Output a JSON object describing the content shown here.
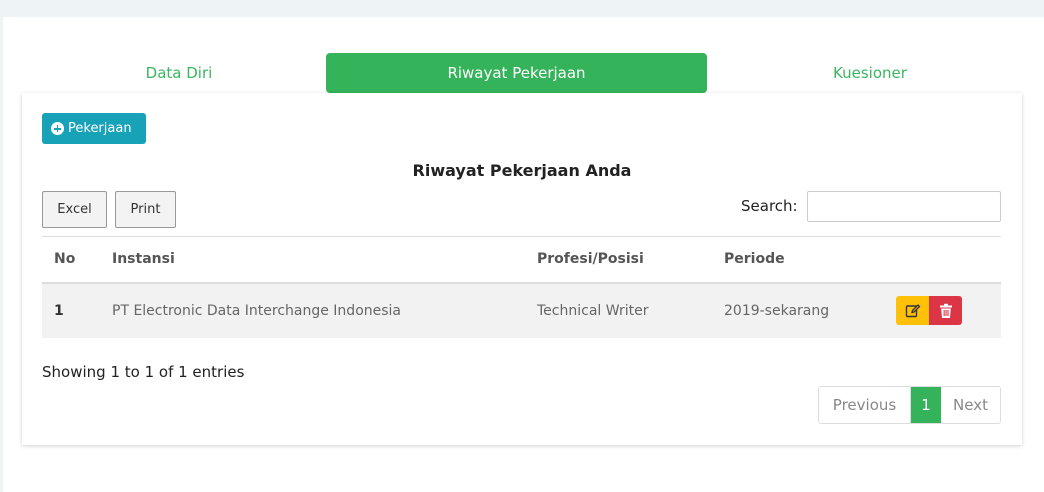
{
  "tabs": [
    {
      "label": "Data Diri",
      "active": false
    },
    {
      "label": "Riwayat Pekerjaan",
      "active": true
    },
    {
      "label": "Kuesioner",
      "active": false
    }
  ],
  "add_button": {
    "label": "Pekerjaan",
    "icon": "plus-circle-icon"
  },
  "table_title": "Riwayat Pekerjaan Anda",
  "export_buttons": {
    "excel": "Excel",
    "print": "Print"
  },
  "search": {
    "label": "Search:",
    "value": ""
  },
  "table": {
    "headers": [
      "No",
      "Instansi",
      "Profesi/Posisi",
      "Periode",
      ""
    ],
    "rows": [
      {
        "no": "1",
        "instansi": "PT Electronic Data Interchange Indonesia",
        "profesi": "Technical Writer",
        "periode": "2019-sekarang"
      }
    ]
  },
  "row_actions": {
    "edit_icon": "edit-icon",
    "delete_icon": "trash-icon"
  },
  "showing_text": "Showing 1 to 1 of 1 entries",
  "pagination": {
    "previous": "Previous",
    "current": "1",
    "next": "Next"
  },
  "colors": {
    "accent": "#34b35a",
    "info": "#17a2b8",
    "warning": "#ffc107",
    "danger": "#dc3545"
  }
}
